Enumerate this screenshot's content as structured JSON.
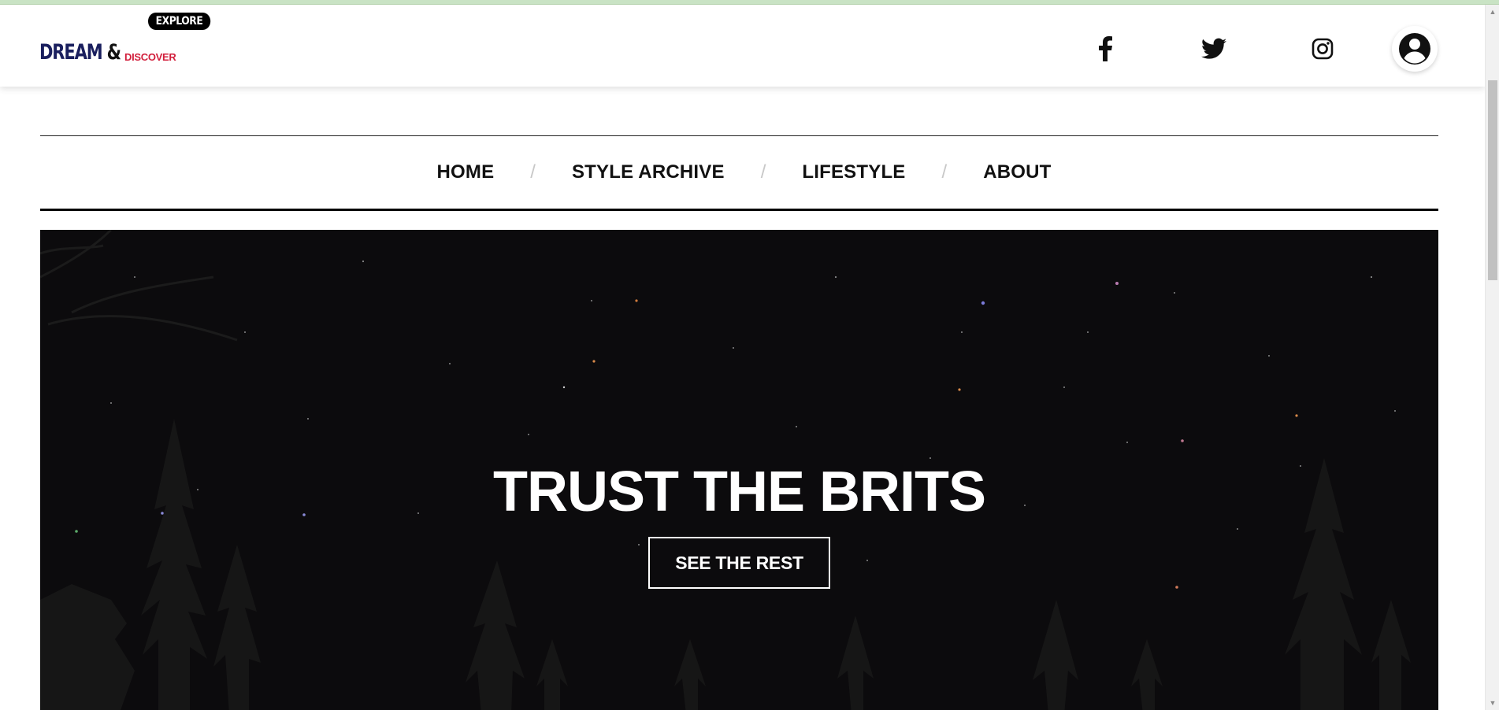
{
  "header": {
    "logo": {
      "badge": "EXPLORE",
      "main_1": "DREAM",
      "main_2": "&",
      "sub": "DISCOVER"
    },
    "social_icons": [
      "facebook-icon",
      "twitter-icon",
      "instagram-icon"
    ],
    "account_icon": "user-circle-icon"
  },
  "nav": {
    "items": [
      {
        "label": "HOME"
      },
      {
        "label": "STYLE ARCHIVE"
      },
      {
        "label": "LIFESTYLE"
      },
      {
        "label": "ABOUT"
      }
    ],
    "separator": "/"
  },
  "hero": {
    "title": "TRUST THE BRITS",
    "cta_label": "SEE THE REST"
  },
  "colors": {
    "brand_navy": "#1a1f5e",
    "brand_red": "#d21f3c",
    "hero_background": "#0c0b0d",
    "nav_separator": "#c8c8c8"
  }
}
